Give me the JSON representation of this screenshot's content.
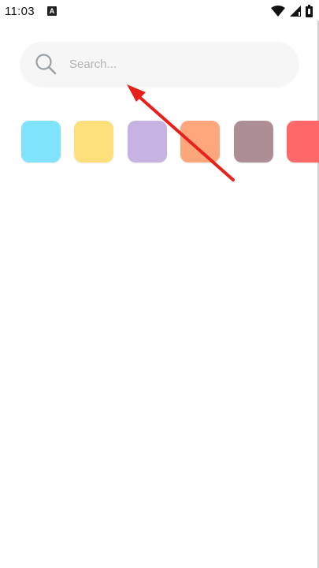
{
  "status_bar": {
    "time": "11:03",
    "notification_glyph": "A",
    "icons": [
      "wifi-icon",
      "cell-signal-icon",
      "battery-icon"
    ]
  },
  "search": {
    "placeholder": "Search...",
    "value": "",
    "icon": "search-icon"
  },
  "color_swatches": [
    {
      "color": "#7fe3fb"
    },
    {
      "color": "#fde07b"
    },
    {
      "color": "#c6b3e2"
    },
    {
      "color": "#fea77c"
    },
    {
      "color": "#ad8e94"
    },
    {
      "color": "#fe6868"
    }
  ],
  "annotation": {
    "color": "#e8201c"
  }
}
